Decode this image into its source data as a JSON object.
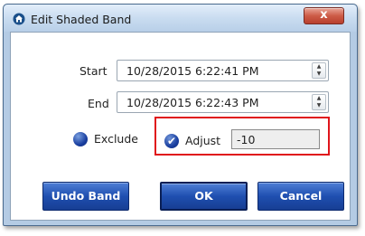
{
  "window": {
    "title": "Edit Shaded Band",
    "close_label": "x"
  },
  "form": {
    "start_label": "Start",
    "start_value": "10/28/2015 6:22:41 PM",
    "end_label": "End",
    "end_value": "10/28/2015 6:22:43 PM",
    "exclude_label": "Exclude",
    "adjust_label": "Adjust",
    "adjust_value": "-10"
  },
  "buttons": {
    "undo_label": "Undo Band",
    "ok_label": "OK",
    "cancel_label": "Cancel"
  },
  "icons": {
    "app": "app-home-icon",
    "close": "close-icon",
    "spin_up": "spin-up-icon",
    "spin_down": "spin-down-icon",
    "radio": "radio-button-icon",
    "check": "checkmark-icon"
  },
  "colors": {
    "button_blue": "#1f4fb0",
    "highlight_red": "#e0151b",
    "close_red": "#cd5b47"
  }
}
